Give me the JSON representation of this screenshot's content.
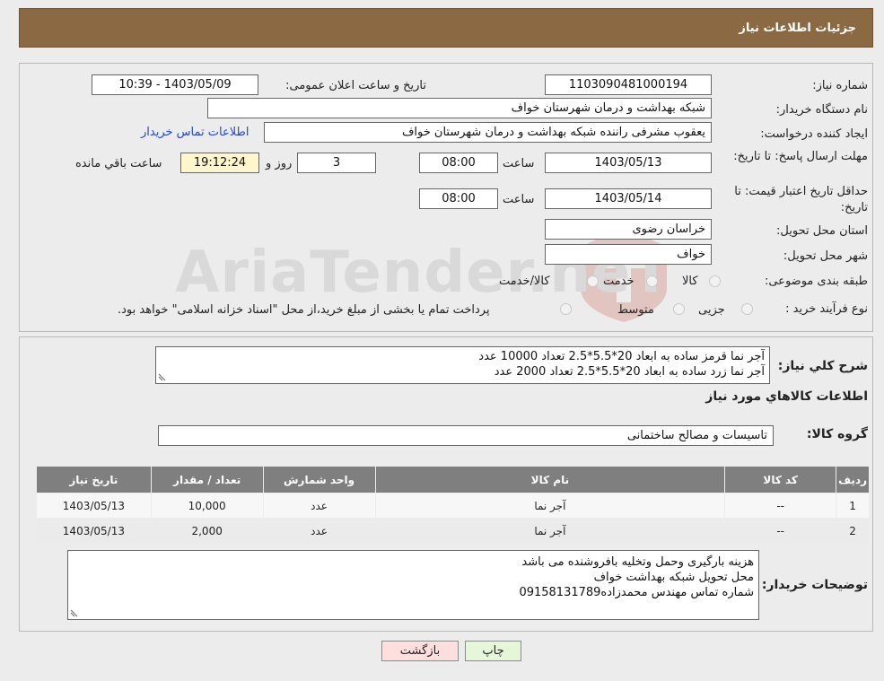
{
  "header": {
    "title": "جزئیات اطلاعات نیاز"
  },
  "form": {
    "need_number_label": "شماره نیاز:",
    "need_number": "1103090481000194",
    "announce_label": "تاریخ و ساعت اعلان عمومی:",
    "announce_value": "1403/05/09 - 10:39",
    "buyer_org_label": "نام دستگاه خریدار:",
    "buyer_org": "شبکه بهداشت و درمان شهرستان خواف",
    "creator_label": "ایجاد کننده درخواست:",
    "creator": "یعقوب مشرفی راننده شبکه بهداشت و درمان شهرستان خواف",
    "contact_link": "اطلاعات تماس خریدار",
    "reply_deadline_label": "مهلت ارسال پاسخ: تا تاریخ:",
    "reply_date": "1403/05/13",
    "time_label": "ساعت",
    "reply_time": "08:00",
    "days_value": "3",
    "days_label": "روز و",
    "remaining_time": "19:12:24",
    "remaining_label": "ساعت باقي مانده",
    "validity_label": "حداقل تاریخ اعتبار قیمت: تا تاریخ:",
    "validity_date": "1403/05/14",
    "validity_time": "08:00",
    "province_label": "استان محل تحویل:",
    "province": "خراسان رضوی",
    "city_label": "شهر محل تحویل:",
    "city": "خواف",
    "category_label": "طبقه بندی موضوعی:",
    "category_options": [
      "کالا",
      "خدمت",
      "کالا/خدمت"
    ],
    "process_label": "نوع فرآیند خرید :",
    "process_options": [
      "جزیی",
      "متوسط"
    ],
    "payment_note": "پرداخت تمام یا بخشی از مبلغ خرید،از محل \"اسناد خزانه اسلامی\" خواهد بود."
  },
  "summary": {
    "label": "شرح كلي نياز:",
    "line1": "آجر نما قرمز ساده به ابعاد 20*5.5*2.5 تعداد 10000 عدد",
    "line2": "آجر نما زرد ساده به ابعاد 20*5.5*2.5 تعداد 2000 عدد"
  },
  "goods": {
    "section_title": "اطلاعات کالاهاي مورد نياز",
    "group_label": "گروه کالا:",
    "group_value": "تاسیسات و مصالح ساختمانی"
  },
  "table": {
    "headers": [
      "رديف",
      "کد کالا",
      "نام کالا",
      "واحد شمارش",
      "تعداد / مقدار",
      "تاریخ نیاز"
    ],
    "rows": [
      [
        "1",
        "--",
        "آجر نما",
        "عدد",
        "10,000",
        "1403/05/13"
      ],
      [
        "2",
        "--",
        "آجر نما",
        "عدد",
        "2,000",
        "1403/05/13"
      ]
    ]
  },
  "notes": {
    "label": "توضیحات خریدار:",
    "line1": "هزینه بارگیری وحمل وتخلیه بافروشنده می باشد",
    "line2": "محل تحویل شبکه بهداشت خواف",
    "line3": "شماره تماس مهندس محمدزاده09158131789"
  },
  "buttons": {
    "print": "چاپ",
    "back": "بازگشت"
  },
  "watermark": {
    "text": "AriaTender.neT"
  },
  "colors": {
    "header_bg": "#8b6a43",
    "link": "#2147d8",
    "back_button_bg": "#ffdede",
    "print_button_bg": "#e6f7d9"
  }
}
